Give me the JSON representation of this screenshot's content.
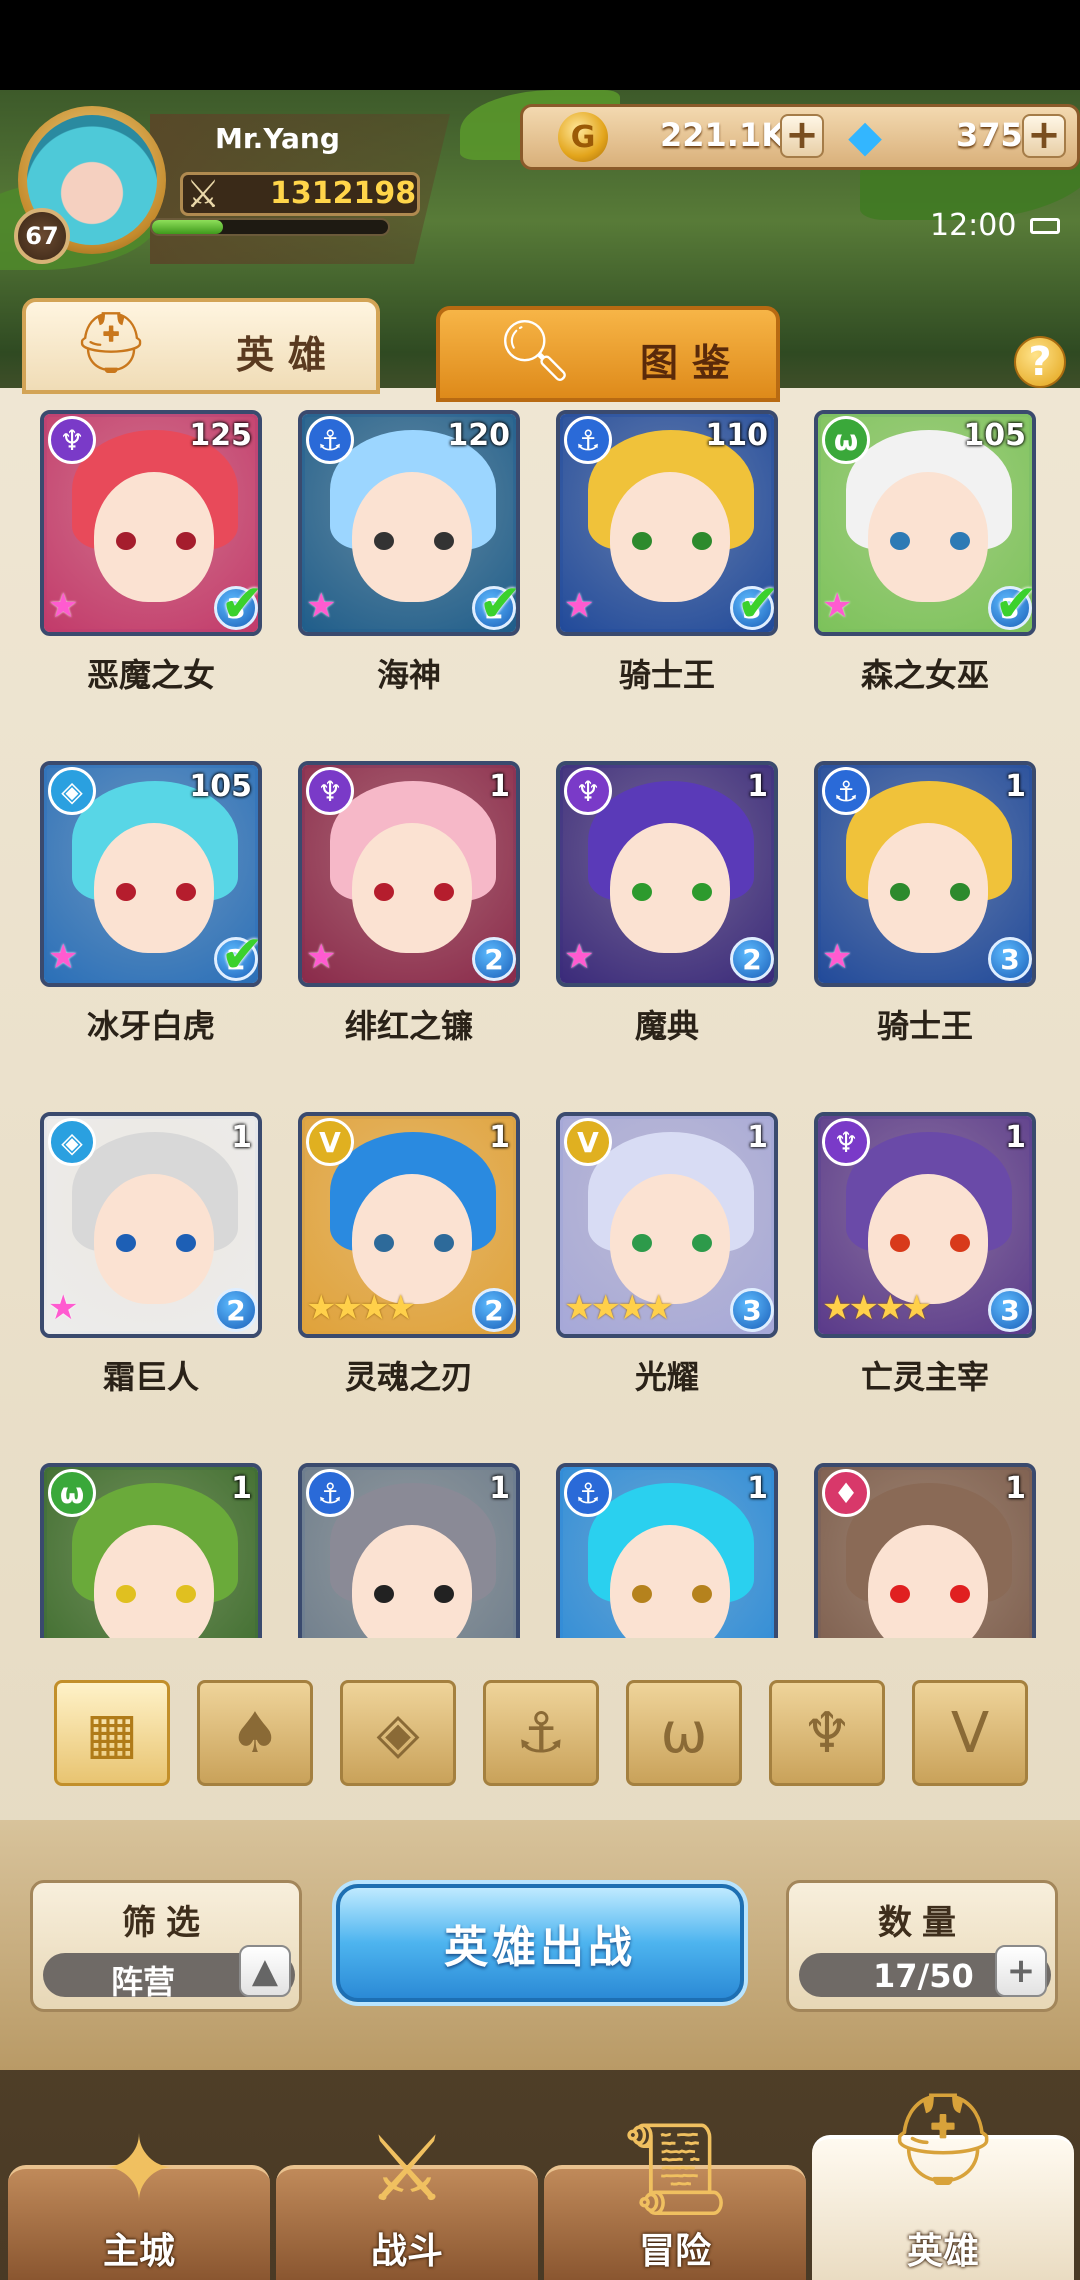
{
  "player": {
    "name": "Mr.Yang",
    "level": "67",
    "power": "1312198",
    "exp_fraction": 0.3
  },
  "currency": {
    "gold": "221.1K",
    "gold_icon": "gold-coin",
    "gems": "375",
    "gem_icon": "blue-diamond"
  },
  "status": {
    "time": "12:00"
  },
  "tabs": [
    {
      "label": "英雄",
      "icon": "helmet"
    },
    {
      "label": "图鉴",
      "icon": "magnifier"
    }
  ],
  "help_label": "?",
  "heroes": [
    {
      "name": "恶魔之女",
      "level": "125",
      "faction": "purple-demon",
      "stars": 1,
      "rank": "3",
      "checked": true,
      "color": "#c23a6a",
      "hair": "#e84a5a",
      "eye": "#a51d2d"
    },
    {
      "name": "海神",
      "level": "120",
      "faction": "blue-anchor",
      "stars": 1,
      "rank": "2",
      "checked": true,
      "color": "#1f5d8a",
      "hair": "#9cd6ff",
      "eye": "#333"
    },
    {
      "name": "骑士王",
      "level": "110",
      "faction": "blue-anchor",
      "stars": 1,
      "rank": "3",
      "checked": true,
      "color": "#214a9a",
      "hair": "#f0c23a",
      "eye": "#2d8a2d"
    },
    {
      "name": "森之女巫",
      "level": "105",
      "faction": "green-beast",
      "stars": 1,
      "rank": "3",
      "checked": true,
      "color": "#7cc25a",
      "hair": "#f2f2f2",
      "eye": "#2d7ab5"
    },
    {
      "name": "冰牙白虎",
      "level": "105",
      "faction": "teal-crystal",
      "stars": 1,
      "rank": "2",
      "checked": true,
      "color": "#2a6fb8",
      "hair": "#58d6e6",
      "eye": "#b51d2d"
    },
    {
      "name": "绯红之镰",
      "level": "1",
      "faction": "purple-demon",
      "stars": 1,
      "rank": "2",
      "checked": false,
      "color": "#8a2a4a",
      "hair": "#f6b8c8",
      "eye": "#b51d2d"
    },
    {
      "name": "魔典",
      "level": "1",
      "faction": "purple-demon",
      "stars": 1,
      "rank": "2",
      "checked": false,
      "color": "#3a2a7a",
      "hair": "#5a3ab8",
      "eye": "#2d9a2d"
    },
    {
      "name": "骑士王",
      "level": "1",
      "faction": "blue-anchor",
      "stars": 1,
      "rank": "3",
      "checked": false,
      "color": "#214a9a",
      "hair": "#f0c23a",
      "eye": "#2d8a2d"
    },
    {
      "name": "霜巨人",
      "level": "1",
      "faction": "teal-crystal",
      "stars": 1,
      "rank": "2",
      "checked": false,
      "color": "#ececec",
      "hair": "#d8d8d8",
      "eye": "#1d5fb5"
    },
    {
      "name": "灵魂之刃",
      "level": "1",
      "faction": "yellow-light",
      "stars": 4,
      "rank": "2",
      "checked": false,
      "color": "#e0a23a",
      "hair": "#2a8ae0",
      "eye": "#2d6a9a"
    },
    {
      "name": "光耀",
      "level": "1",
      "faction": "yellow-light",
      "stars": 4,
      "rank": "3",
      "checked": false,
      "color": "#a6a8d8",
      "hair": "#d8dcf4",
      "eye": "#2d9a4a"
    },
    {
      "name": "亡灵主宰",
      "level": "1",
      "faction": "purple-demon",
      "stars": 4,
      "rank": "3",
      "checked": false,
      "color": "#5a3a8a",
      "hair": "#6a4aa8",
      "eye": "#d83a1a"
    },
    {
      "name": "",
      "level": "1",
      "faction": "green-beast",
      "stars": 0,
      "rank": "",
      "checked": false,
      "color": "#3a6a2a",
      "hair": "#6aaa3a",
      "eye": "#e0c020"
    },
    {
      "name": "",
      "level": "1",
      "faction": "blue-anchor",
      "stars": 0,
      "rank": "",
      "checked": false,
      "color": "#6a7a8a",
      "hair": "#8a8a96",
      "eye": "#222"
    },
    {
      "name": "",
      "level": "1",
      "faction": "blue-anchor",
      "stars": 0,
      "rank": "",
      "checked": false,
      "color": "#2a8ad8",
      "hair": "#2ad0ef",
      "eye": "#b5821d"
    },
    {
      "name": "",
      "level": "1",
      "faction": "red-flame",
      "stars": 0,
      "rank": "",
      "checked": false,
      "color": "#7a5a4a",
      "hair": "#8a6a56",
      "eye": "#e02020"
    }
  ],
  "filters": [
    "all-grid",
    "flame",
    "crystal",
    "anchor",
    "beast",
    "demon",
    "light"
  ],
  "controls": {
    "filter_title": "筛选",
    "filter_value": "阵营",
    "filter_toggle": "▲",
    "battle_label": "英雄出战",
    "count_title": "数量",
    "count_value": "17/50",
    "count_add": "+"
  },
  "nav": [
    {
      "label": "主城",
      "icon": "castle-gem"
    },
    {
      "label": "战斗",
      "icon": "crossed-swords"
    },
    {
      "label": "冒险",
      "icon": "scroll-map"
    },
    {
      "label": "英雄",
      "icon": "golden-helmet"
    }
  ]
}
